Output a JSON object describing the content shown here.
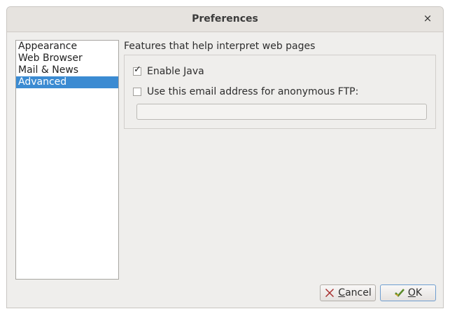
{
  "window": {
    "title": "Preferences",
    "close_glyph": "×"
  },
  "sidebar": {
    "items": [
      {
        "label": "Appearance",
        "selected": false
      },
      {
        "label": "Web Browser",
        "selected": false
      },
      {
        "label": "Mail & News",
        "selected": false
      },
      {
        "label": "Advanced",
        "selected": true
      }
    ]
  },
  "main": {
    "section_title": "Features that help interpret web pages",
    "enable_java": {
      "label": "Enable Java",
      "checked": true
    },
    "anon_ftp": {
      "label": "Use this email address for anonymous FTP:",
      "checked": false,
      "value": ""
    }
  },
  "buttons": {
    "cancel": {
      "first": "C",
      "rest": "ancel",
      "icon": "x-icon"
    },
    "ok": {
      "first": "O",
      "rest": "K",
      "icon": "checkmark-icon"
    }
  },
  "colors": {
    "selection": "#3b8bd2",
    "window_bg": "#efeeec"
  }
}
